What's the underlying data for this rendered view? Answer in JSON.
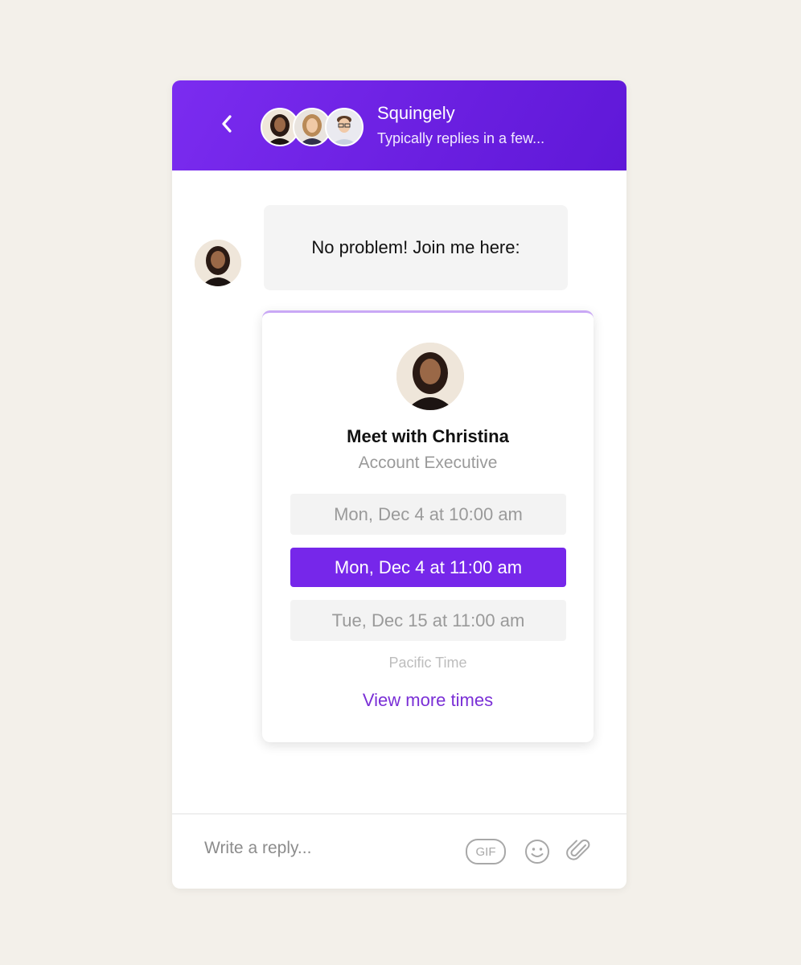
{
  "header": {
    "back_icon": "chevron-left-icon",
    "team_name": "Squingely",
    "status": "Typically replies in a few..."
  },
  "message": {
    "text": "No problem! Join me here:"
  },
  "meeting_card": {
    "title": "Meet with Christina",
    "subtitle": "Account Executive",
    "slots": [
      {
        "label": "Mon, Dec 4 at 10:00 am",
        "selected": false
      },
      {
        "label": "Mon, Dec 4 at 11:00 am",
        "selected": true
      },
      {
        "label": "Tue, Dec 15 at 11:00 am",
        "selected": false
      }
    ],
    "timezone": "Pacific Time",
    "more_link": "View more times"
  },
  "composer": {
    "placeholder": "Write a reply...",
    "gif_label": "GIF",
    "icons": [
      "emoji-icon",
      "paperclip-icon"
    ]
  },
  "colors": {
    "brand": "#7627ea",
    "link": "#7a2fd6",
    "page_background": "#f3f0ea"
  }
}
